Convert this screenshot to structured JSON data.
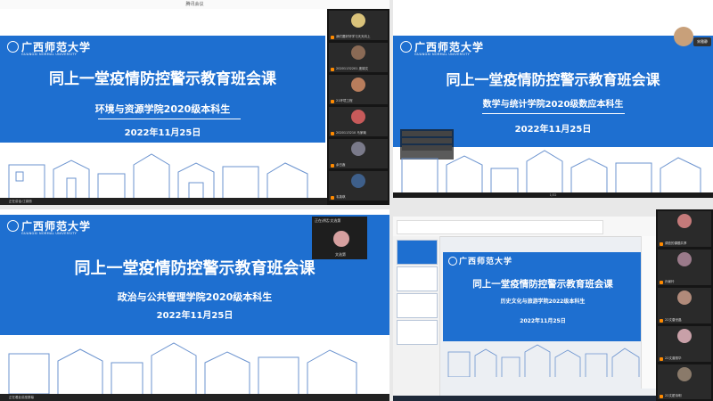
{
  "meeting": {
    "title": "腾讯会议"
  },
  "common": {
    "university_logo": "广西师范大学",
    "university_en": "GUANGXI NORMAL UNIVERSITY",
    "course_title": "同上一堂疫情防控警示教育班会课",
    "date": "2022年11月25日"
  },
  "panel1": {
    "subtitle": "环境与资源学院2020级本科生",
    "participants": [
      {
        "name": "我们要好好学习天天向上"
      },
      {
        "name": "20201132201 庞锦文"
      },
      {
        "name": "21环境工程"
      },
      {
        "name": "2020113210 马家瑜"
      },
      {
        "name": "余日鑫"
      },
      {
        "name": "韦英琪"
      }
    ],
    "status": "正在讲话:江锦丽"
  },
  "panel2": {
    "subtitle": "数学与统计学院2020级数应本科生",
    "host_chip": "宋雅静",
    "footer": "1/32",
    "overlay_lines": [
      "",
      "",
      "",
      ""
    ]
  },
  "panel3": {
    "subtitle": "政治与公共管理学院2020级本科生",
    "speaking_chip": "正在讲话:文选第",
    "self_name": "文选第",
    "status": "正在看此讲座屏幕"
  },
  "panel4": {
    "subtitle": "历史文化与旅游学院2022级本科生",
    "participants": [
      {
        "name": "调查的课题共享"
      },
      {
        "name": "孙景玲"
      },
      {
        "name": "22文唐世晶"
      },
      {
        "name": "22文曾丽华"
      },
      {
        "name": "22文翟诗明"
      }
    ]
  },
  "colors": {
    "banner": "#1e6fd0",
    "dark": "#151515",
    "accent": "#ff8a00"
  }
}
